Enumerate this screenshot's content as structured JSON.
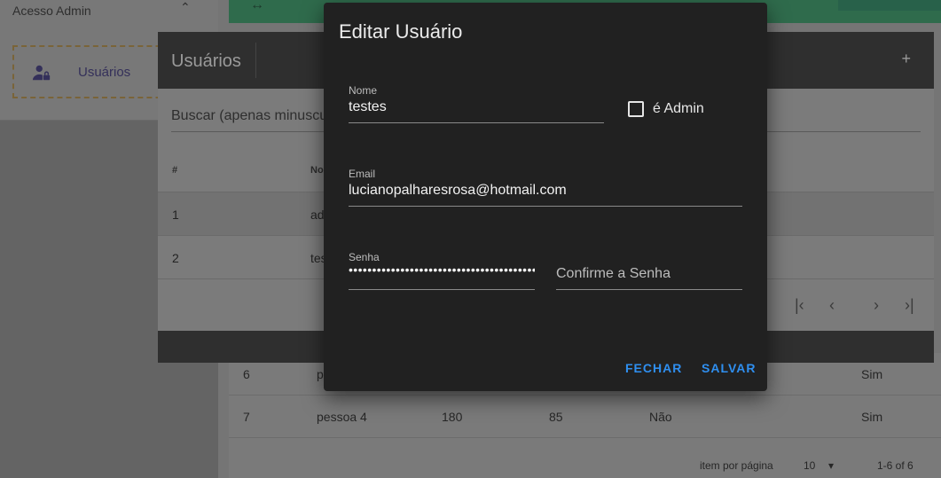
{
  "sidebar": {
    "section_title": "Acesso Admin",
    "item_label": "Usuários"
  },
  "background_table": {
    "rows": [
      {
        "id": "6",
        "name": "p",
        "c3": "",
        "c4": "",
        "c5": "",
        "c6": "Sim"
      },
      {
        "id": "7",
        "name": "pessoa 4",
        "c3": "180",
        "c4": "85",
        "c5": "Não",
        "c6": "Sim"
      }
    ],
    "footer": {
      "items_per_page_label": "item por página",
      "page_size": "10",
      "range": "1-6 of 6"
    }
  },
  "users_card": {
    "title": "Usuários",
    "search_placeholder": "Buscar (apenas minuscu",
    "header_number": "#",
    "header_name": "No",
    "rows": [
      {
        "id": "1",
        "name_fragment": "ad"
      },
      {
        "id": "2",
        "name_fragment": "tes"
      }
    ]
  },
  "dialog": {
    "title": "Editar Usuário",
    "name_label": "Nome",
    "name_value": "testes",
    "admin_label": "é Admin",
    "admin_checked": false,
    "email_label": "Email",
    "email_value": "lucianopalharesrosa@hotmail.com",
    "password_label": "Senha",
    "password_value": "••••••••••••••••••••••••••••••••••••••••",
    "confirm_placeholder": "Confirme a Senha",
    "close_label": "FECHAR",
    "save_label": "SALVAR"
  },
  "colors": {
    "dialog_bg": "#212121",
    "accent_blue": "#2f8ff0",
    "topbar_green": "#2f6b4c"
  }
}
